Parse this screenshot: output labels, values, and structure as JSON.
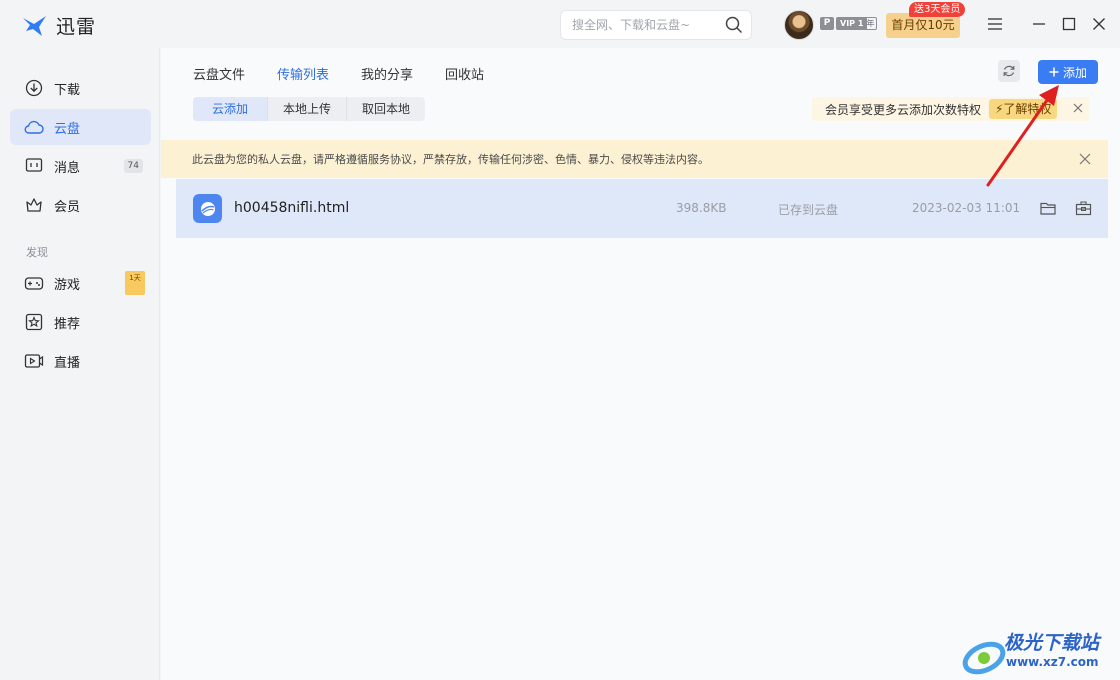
{
  "app": {
    "title": "迅雷"
  },
  "search": {
    "placeholder": "搜全网、下载和云盘~"
  },
  "account": {
    "badge_p": "P",
    "badge_vip": "VIP 1",
    "badge_year": "年",
    "promo_label": "首月仅10元",
    "promo_tag": "送3天会员"
  },
  "sidebar": {
    "items": [
      {
        "label": "下载",
        "icon": "download-icon"
      },
      {
        "label": "云盘",
        "icon": "cloud-icon",
        "active": true
      },
      {
        "label": "消息",
        "icon": "message-icon",
        "count": "74"
      },
      {
        "label": "会员",
        "icon": "crown-icon"
      }
    ],
    "section_label": "发现",
    "discover_items": [
      {
        "label": "游戏",
        "icon": "gamepad-icon",
        "tag": "1天"
      },
      {
        "label": "推荐",
        "icon": "star-icon"
      },
      {
        "label": "直播",
        "icon": "live-icon"
      }
    ]
  },
  "main": {
    "tabs": [
      {
        "label": "云盘文件"
      },
      {
        "label": "传输列表",
        "active": true
      },
      {
        "label": "我的分享"
      },
      {
        "label": "回收站"
      }
    ],
    "add_button_label": "添加",
    "subtabs": [
      {
        "label": "云添加",
        "active": true
      },
      {
        "label": "本地上传"
      },
      {
        "label": "取回本地"
      }
    ],
    "vip_hint": {
      "text": "会员享受更多云添加次数特权",
      "link_label": "⚡了解特权"
    },
    "warning": "此云盘为您的私人云盘，请严格遵循服务协议，严禁存放，传输任何涉密、色情、暴力、侵权等违法内容。",
    "files": [
      {
        "name": "h00458nifli.html",
        "size": "398.8KB",
        "status": "已存到云盘",
        "time": "2023-02-03 11:01"
      }
    ]
  },
  "watermark": {
    "text": "极光下载站",
    "url": "www.xz7.com"
  },
  "colors": {
    "accent": "#3a7cf4",
    "arrow": "#e02020",
    "warning_bg": "#fdf1d3"
  }
}
